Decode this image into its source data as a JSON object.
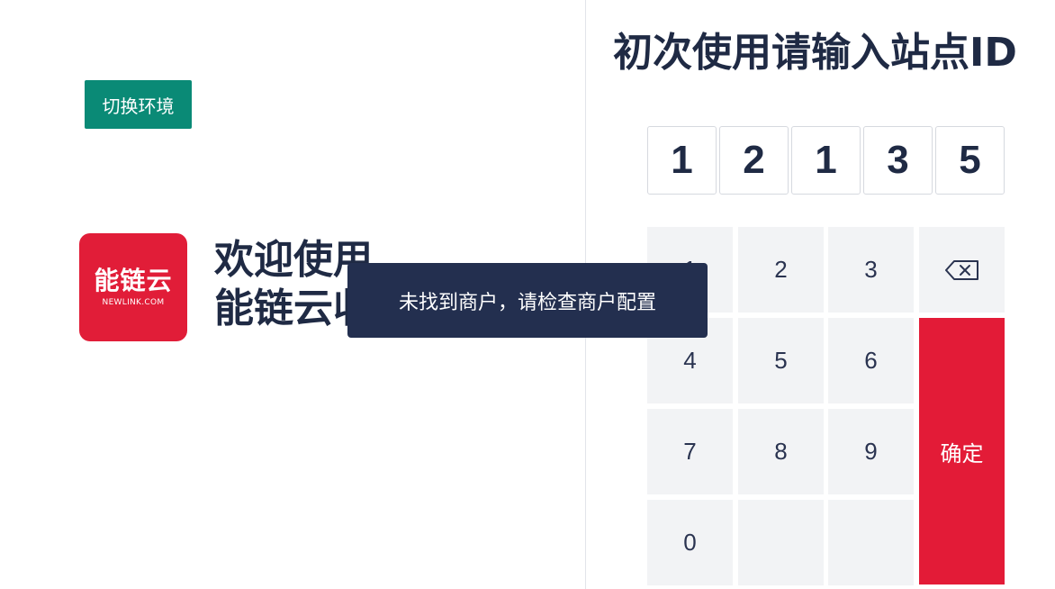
{
  "left": {
    "env_button": "切换环境",
    "logo": {
      "cn": "能链云",
      "en": "NEWLINK.COM"
    },
    "welcome_line1": "欢迎使用",
    "welcome_line2": "能链云收银台"
  },
  "right": {
    "title": "初次使用请输入站点ID",
    "digits": [
      "1",
      "2",
      "1",
      "3",
      "5"
    ],
    "keypad": {
      "keys": [
        "1",
        "2",
        "3",
        "4",
        "5",
        "6",
        "7",
        "8",
        "9",
        "0"
      ],
      "backspace_icon": "backspace-icon",
      "confirm": "确定"
    }
  },
  "toast": {
    "message": "未找到商户，请检查商户配置"
  },
  "colors": {
    "brand_red": "#e31b37",
    "env_button": "#0a8a76",
    "toast_bg": "#232f4f",
    "text_dark": "#1f2a44",
    "key_bg": "#f2f3f5"
  }
}
